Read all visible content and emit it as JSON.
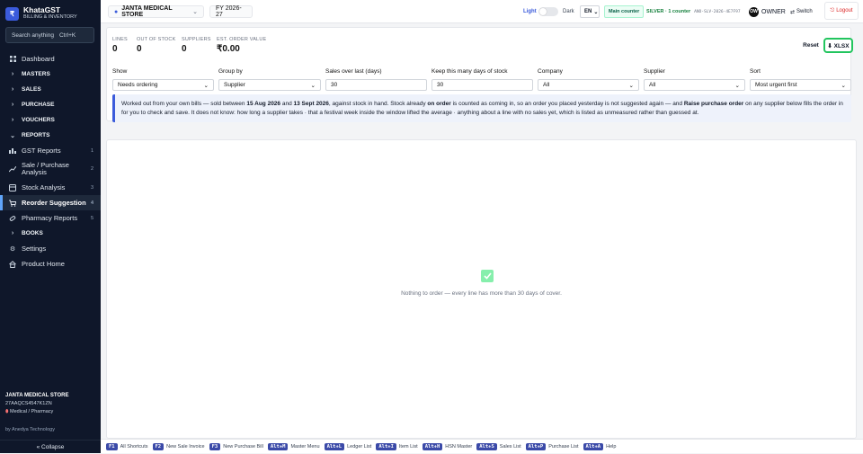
{
  "sidebar": {
    "brand_logo": "₹",
    "brand_name": "KhataGST",
    "brand_sub": "BILLING & INVENTORY",
    "search_placeholder": "Search anything",
    "search_shortcut": "Ctrl+K",
    "items": [
      {
        "label": "Dashboard",
        "icon": "grid-icon"
      },
      {
        "label": "MASTERS",
        "icon": "chevron-right-icon"
      },
      {
        "label": "SALES",
        "icon": "chevron-right-icon"
      },
      {
        "label": "PURCHASE",
        "icon": "chevron-right-icon"
      },
      {
        "label": "VOUCHERS",
        "icon": "chevron-right-icon"
      },
      {
        "label": "REPORTS",
        "icon": "chevron-down-icon"
      },
      {
        "label": "GST Reports",
        "count": "1"
      },
      {
        "label": "Sale / Purchase Analysis",
        "count": "2"
      },
      {
        "label": "Stock Analysis",
        "count": "3"
      },
      {
        "label": "Reorder Suggestion",
        "count": "4"
      },
      {
        "label": "Pharmacy Reports",
        "count": "5"
      },
      {
        "label": "BOOKS",
        "icon": "chevron-right-icon"
      },
      {
        "label": "Settings",
        "icon": "gear-icon"
      },
      {
        "label": "Product Home",
        "icon": "home-icon"
      }
    ],
    "store_name": "JANTA MEDICAL STORE",
    "store_gstin": "27AAQCS4547K1ZN",
    "store_type": "Medical / Pharmacy",
    "byline": "by Anedya Technology",
    "collapse": "« Collapse"
  },
  "topbar": {
    "store": "JANTA MEDICAL STORE",
    "fy": "FY 2026-27",
    "light": "Light",
    "dark": "Dark",
    "lang": "EN",
    "counter": "Main counter",
    "plan": "SILVER · 1 counter",
    "plan_code": "ANO-SLV-2026-4E7F97",
    "avatar": "OW",
    "role": "OWNER",
    "switch": "Switch",
    "logout": "Logout"
  },
  "kpis": [
    {
      "label": "LINES",
      "value": "0"
    },
    {
      "label": "OUT OF STOCK",
      "value": "0"
    },
    {
      "label": "SUPPLIERS",
      "value": "0"
    },
    {
      "label": "EST. ORDER VALUE",
      "value": "₹0.00"
    }
  ],
  "actions": {
    "reset": "Reset",
    "xlsx": "⬇ XLSX"
  },
  "filters": [
    {
      "label": "Show",
      "value": "Needs ordering",
      "select": true
    },
    {
      "label": "Group by",
      "value": "Supplier",
      "select": true
    },
    {
      "label": "Sales over last (days)",
      "value": "30",
      "select": false
    },
    {
      "label": "Keep this many days of stock",
      "value": "30",
      "select": false
    },
    {
      "label": "Company",
      "value": "All",
      "select": true
    },
    {
      "label": "Supplier",
      "value": "All",
      "select": true
    },
    {
      "label": "Sort",
      "value": "Most urgent first",
      "select": true
    }
  ],
  "info": {
    "t1": "Worked out from your own bills — sold between ",
    "d1": "15 Aug 2026",
    "t2": " and ",
    "d2": "13 Sept 2026",
    "t3": ", against stock in hand. Stock already ",
    "b1": "on order",
    "t4": " is counted as coming in, so an order you placed yesterday is not suggested again — and ",
    "b2": "Raise purchase order",
    "t5": " on any supplier below fills the order in for you to check and save. It does not know: how long a supplier takes · that a festival week inside the window lifted the average · anything about a line with no sales yet, which is listed as unmeasured rather than guessed at."
  },
  "empty": {
    "message": "Nothing to order — every line has more than 30 days of cover."
  },
  "footer": [
    {
      "key": "F1",
      "label": "All Shortcuts"
    },
    {
      "key": "F2",
      "label": "New Sale Invoice"
    },
    {
      "key": "F3",
      "label": "New Purchase Bill"
    },
    {
      "key": "Alt+M",
      "label": "Master Menu"
    },
    {
      "key": "Alt+L",
      "label": "Ledger List"
    },
    {
      "key": "Alt+I",
      "label": "Item List"
    },
    {
      "key": "Alt+H",
      "label": "HSN Master"
    },
    {
      "key": "Alt+S",
      "label": "Sales List"
    },
    {
      "key": "Alt+P",
      "label": "Purchase List"
    },
    {
      "key": "Alt+A",
      "label": "Help"
    }
  ],
  "colors": {
    "sidebar_bg": "#0f172a",
    "accent": "#3b5bdb",
    "xlsx_border": "#22c55e",
    "logout": "#dc2626"
  }
}
